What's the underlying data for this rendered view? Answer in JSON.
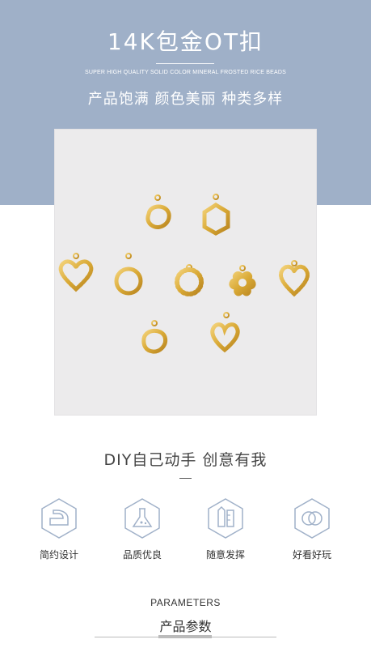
{
  "header": {
    "title": "14K包金OT扣",
    "subtitle_en": "SUPER HIGH QUALITY SOLID COLOR MINERAL FROSTED RICE BEADS",
    "tagline": "产品饱满 颜色美丽 种类多样"
  },
  "colors": {
    "banner": "#9fb0c8",
    "gold": "#d9a936",
    "photo_bg": "#ecebec"
  },
  "slogan": "DIY自己动手 创意有我",
  "features": [
    {
      "label": "简约设计",
      "icon": "iron-icon"
    },
    {
      "label": "品质优良",
      "icon": "flask-icon"
    },
    {
      "label": "随意发挥",
      "icon": "stationery-icon"
    },
    {
      "label": "好看好玩",
      "icon": "interlocking-rings-icon"
    }
  ],
  "parameters": {
    "title_en": "PARAMETERS",
    "title_cn": "产品参数"
  }
}
